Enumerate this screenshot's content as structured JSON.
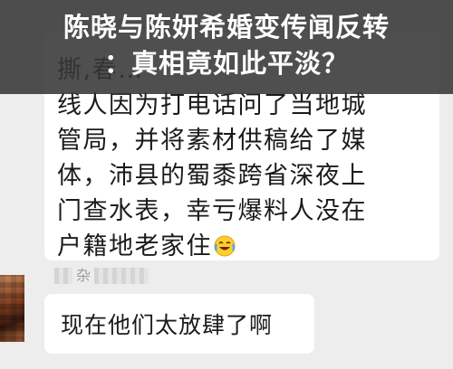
{
  "headline": {
    "line1": "陈晓与陈妍希婚变传闻反转",
    "line2": "：真相竟如此平淡？"
  },
  "chat": {
    "message1": {
      "text": "撕,春…\n线人因为打电话问了当地城\n管局，并将素材供稿给了媒\n体，沛县的蜀黍跨省深夜上\n门查水表，幸亏爆料人没在\n户籍地老家住",
      "trailing_emoji": "crying-laughing-emoji"
    },
    "message2": {
      "sender_visible": "杂",
      "text": "现在他们太放肆了啊"
    }
  }
}
